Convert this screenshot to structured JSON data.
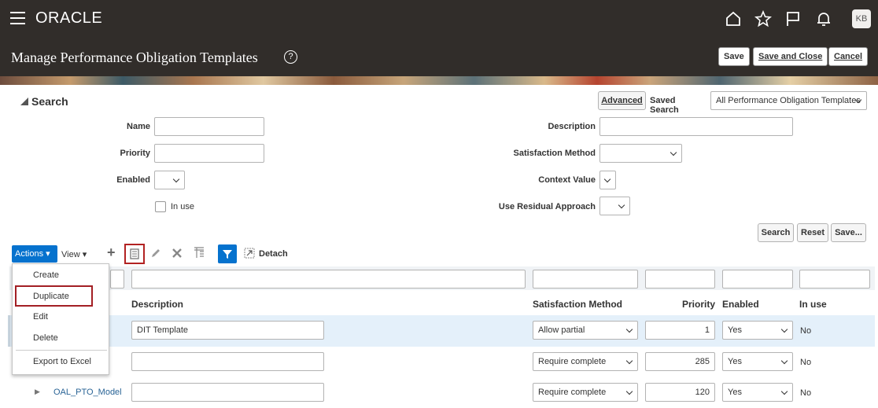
{
  "header": {
    "logo": "ORACLE",
    "avatar": "KB"
  },
  "page": {
    "title": "Manage Performance Obligation Templates",
    "help": "?",
    "save": "Save",
    "save_close": "Save and Close",
    "cancel": "Cancel"
  },
  "search": {
    "heading": "Search",
    "advanced": "Advanced",
    "saved_search_label": "Saved Search",
    "saved_search_value": "All Performance Obligation Templates",
    "fields": {
      "name": "Name",
      "priority": "Priority",
      "enabled": "Enabled",
      "in_use": "In use",
      "description": "Description",
      "satisfaction_method": "Satisfaction Method",
      "context_value": "Context Value",
      "use_residual": "Use Residual Approach"
    },
    "buttons": {
      "search": "Search",
      "reset": "Reset",
      "save": "Save..."
    }
  },
  "toolbar": {
    "actions": "Actions",
    "view": "View",
    "detach": "Detach"
  },
  "actions_menu": [
    "Create",
    "Duplicate",
    "Edit",
    "Delete",
    "Export to Excel"
  ],
  "grid": {
    "columns": [
      "Description",
      "Satisfaction Method",
      "Priority",
      "Enabled",
      "In use"
    ],
    "rows": [
      {
        "name": "",
        "description": "DIT Template",
        "method": "Allow partial",
        "priority": "1",
        "enabled": "Yes",
        "in_use": "No"
      },
      {
        "name": "",
        "description": "",
        "method": "Require complete",
        "priority": "285",
        "enabled": "Yes",
        "in_use": "No"
      },
      {
        "name": "OAL_PTO_Model",
        "description": "",
        "method": "Require complete",
        "priority": "120",
        "enabled": "Yes",
        "in_use": "No"
      }
    ]
  }
}
